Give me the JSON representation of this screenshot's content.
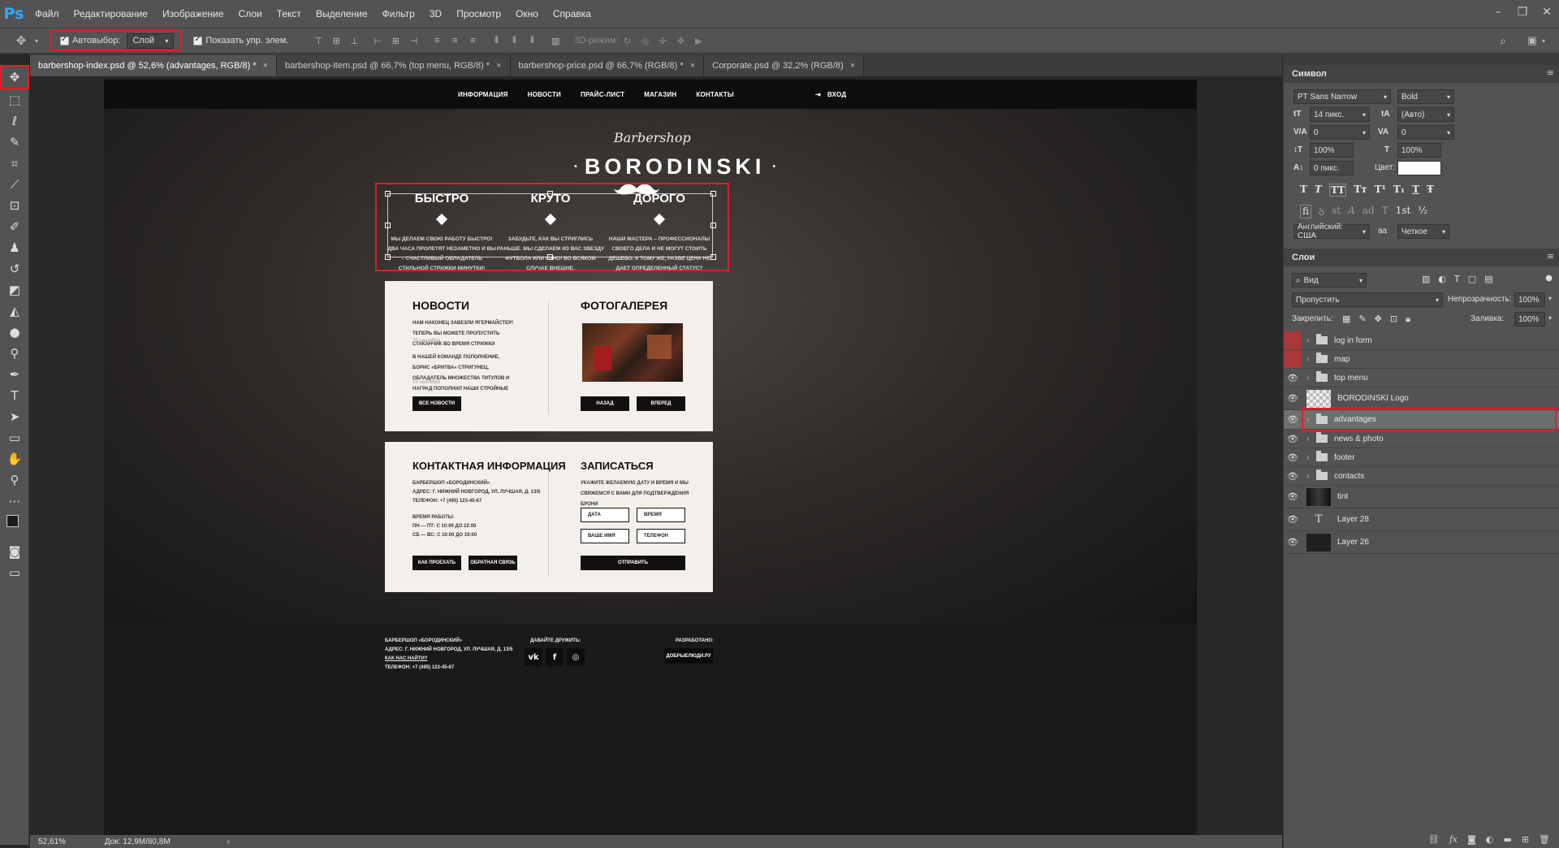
{
  "app": {
    "logo": "Ps"
  },
  "menu": [
    "Файл",
    "Редактирование",
    "Изображение",
    "Слои",
    "Текст",
    "Выделение",
    "Фильтр",
    "3D",
    "Просмотр",
    "Окно",
    "Справка"
  ],
  "window_controls": [
    "–",
    "❐",
    "✕"
  ],
  "options": {
    "autoselect_label": "Автовыбор:",
    "autoselect_value": "Слой",
    "show_transform_label": "Показать упр. элем.",
    "mode_3d_label": "3D-режим:"
  },
  "tabs": [
    {
      "label": "barbershop-index.psd @ 52,6% (advantages, RGB/8) *",
      "close": "×",
      "active": true
    },
    {
      "label": "barbershop-item.psd @ 66,7% (top menu, RGB/8) *",
      "close": "×"
    },
    {
      "label": "barbershop-price.psd @ 66,7% (RGB/8) *",
      "close": "×"
    },
    {
      "label": "Corporate.psd @ 32,2% (RGB/8)",
      "close": "×"
    }
  ],
  "tools": [
    "move-tool",
    "marquee-tool",
    "lasso-tool",
    "quick-select-tool",
    "crop-tool",
    "eyedropper-tool",
    "frame-tool",
    "brush-tool",
    "stamp-tool",
    "history-brush-tool",
    "eraser-tool",
    "gradient-tool",
    "blur-tool",
    "dodge-tool",
    "pen-tool",
    "type-tool",
    "path-select-tool",
    "shape-tool",
    "hand-tool",
    "zoom-tool",
    "more-tool"
  ],
  "document": {
    "nav": [
      "ИНФОРМАЦИЯ",
      "НОВОСТИ",
      "ПРАЙС-ЛИСТ",
      "МАГАЗИН",
      "КОНТАКТЫ"
    ],
    "login": "ВХОД",
    "brand_script": "Barbershop",
    "brand_name": "BORODINSKI",
    "advantages": [
      {
        "title": "БЫСТРО",
        "text": "МЫ ДЕЛАЕМ СВОЮ РАБОТУ БЫСТРО! ДВА ЧАСА ПРОЛЕТЯТ НЕЗАМЕТНО И ВЫ – СЧАСТЛИВЫЙ ОБЛАДАТЕЛЬ СТИЛЬНОЙ СТРИЖКИ-МИНУТКИ!"
      },
      {
        "title": "КРУТО",
        "text": "ЗАБУДЬТЕ, КАК ВЫ СТРИГЛИСЬ РАНЬШЕ. МЫ СДЕЛАЕМ ИЗ ВАС ЗВЕЗДУ ФУТБОЛА ИЛИ КИНО! ВО ВСЯКОМ СЛУЧАЕ ВНЕШНЕ."
      },
      {
        "title": "ДОРОГО",
        "text": "НАШИ МАСТЕРА – ПРОФЕССИОНАЛЫ СВОЕГО ДЕЛА И НЕ МОГУТ СТОИТЬ ДЕШЕВО. К ТОМУ ЖЕ, РАЗВЕ ЦЕНА НЕ ДАЕТ ОПРЕДЕЛЕННЫЙ СТАТУС?"
      }
    ],
    "news": {
      "title": "НОВОСТИ",
      "item1": "НАМ НАКОНЕЦ ЗАВЕЗЛИ ЯГЕРМАЙСТЕР! ТЕПЕРЬ ВЫ МОЖЕТЕ ПРОПУСТИТЬ СТАКАНЧИК ВО ВРЕМЯ СТРИЖКИ",
      "date1": "25 сентября",
      "item2": "В НАШЕЙ КОМАНДЕ ПОПОЛНЕНИЕ, БОРИС «БРИТВА» СТРИГУНЕЦ, ОБЛАДАТЕЛЬ МНОЖЕСТВА ТИТУЛОВ И НАГРАД ПОПОЛНИЛ НАШИ СТРОЙНЫЕ РЯДЫ",
      "date2": "19 сентября",
      "button": "ВСЕ НОВОСТИ"
    },
    "gallery": {
      "title": "ФОТОГАЛЕРЕЯ",
      "prev": "НАЗАД",
      "next": "ВПЕРЕД"
    },
    "contacts": {
      "title": "КОНТАКТНАЯ ИНФОРМАЦИЯ",
      "line1": "БАРБЕРШОП «БОРОДИНСКИЙ»",
      "line2": "АДРЕС: Г. НИЖНИЙ НОВГОРОД, УЛ. ЛУЧШАЯ, Д. 13/5",
      "line3": "ТЕЛЕФОН: +7 (495) 123-45-67",
      "hours_title": "ВРЕМЯ РАБОТЫ:",
      "hours1": "ПН — ПТ: С 10:00 ДО 22:00",
      "hours2": "СБ — ВС: С 10:00 ДО 19:00",
      "btn_route": "КАК ПРОЕХАТЬ",
      "btn_feedback": "ОБРАТНАЯ СВЯЗЬ"
    },
    "booking": {
      "title": "ЗАПИСАТЬСЯ",
      "text": "УКАЖИТЕ ЖЕЛАЕМУЮ ДАТУ И ВРЕМЯ И МЫ СВЯЖЕМСЯ С ВАМИ ДЛЯ ПОДТВЕРЖДЕНИЯ БРОНИ",
      "date": "ДАТА",
      "time": "ВРЕМЯ",
      "name": "ВАШЕ ИМЯ",
      "phone": "ТЕЛЕФОН",
      "submit": "ОТПРАВИТЬ"
    },
    "footer": {
      "line1": "БАРБЕРШОП «БОРОДИНСКИЙ»",
      "line2": "АДРЕС: Г. НИЖНИЙ НОВГОРОД, УЛ. ЛУЧШАЯ, Д. 13/5",
      "line3": "КАК НАС НАЙТИ?",
      "line4": "ТЕЛЕФОН: +7 (495) 123-45-67",
      "friends": "ДАВАЙТЕ ДРУЖИТЬ:",
      "social": [
        "vk",
        "f",
        "◎"
      ],
      "dev_label": "РАЗРАБОТАНО:",
      "dev_button": "ДОБРЫЕЛЮДИ.РУ"
    }
  },
  "character_panel": {
    "title": "Символ",
    "font": "PT Sans Narrow",
    "style": "Bold",
    "size": "14 пикс.",
    "leading": "(Авто)",
    "kerning": "0",
    "tracking": "0",
    "vscale": "100%",
    "hscale": "100%",
    "baseline": "0 пикс.",
    "color_label": "Цвет:",
    "language": "Английский: США",
    "aa_label": "aa",
    "antialias": "Четкое",
    "type_buttons": [
      "T",
      "T",
      "TT",
      "Tт",
      "T¹",
      "T₁",
      "T",
      "Ŧ"
    ],
    "opentype_buttons": [
      "fi",
      "ꝺ",
      "st",
      "A",
      "ad",
      "T",
      "1st",
      "½"
    ]
  },
  "layers_panel": {
    "title": "Слои",
    "filter": "Вид",
    "blend_mode": "Пропустить",
    "opacity_label": "Непрозрачность:",
    "opacity": "100%",
    "lock_label": "Закрепить:",
    "fill_label": "Заливка:",
    "fill": "100%",
    "layers": [
      {
        "name": "log in form",
        "type": "group",
        "visible": false
      },
      {
        "name": "map",
        "type": "group",
        "visible": false
      },
      {
        "name": "top menu",
        "type": "group",
        "visible": true
      },
      {
        "name": "BORODINSKI Logo",
        "type": "smart",
        "visible": true
      },
      {
        "name": "advantages",
        "type": "group",
        "visible": true,
        "selected": true
      },
      {
        "name": "news & photo",
        "type": "group",
        "visible": true
      },
      {
        "name": "footer",
        "type": "group",
        "visible": true
      },
      {
        "name": "contacts",
        "type": "group",
        "visible": true
      },
      {
        "name": "tint",
        "type": "image",
        "visible": true
      },
      {
        "name": "Layer 28",
        "type": "text",
        "visible": true
      },
      {
        "name": "Layer 26",
        "type": "image",
        "visible": true
      }
    ]
  },
  "status": {
    "zoom": "52,61%",
    "doc": "Док: 12,9M/80,8M"
  },
  "colors": {
    "accent_red": "#e41e25",
    "ps_blue": "#31a8ff",
    "panel": "#535353"
  }
}
